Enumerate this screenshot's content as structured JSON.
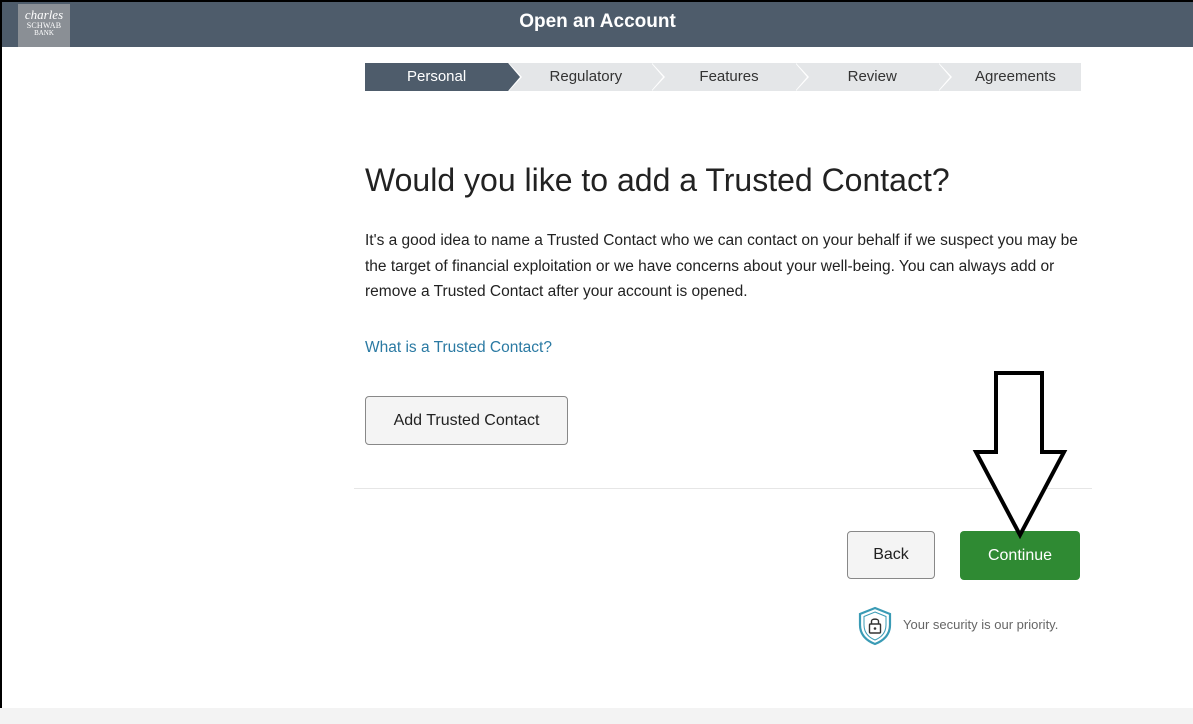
{
  "header": {
    "logo": {
      "line1": "charles",
      "line2": "SCHWAB",
      "line3": "BANK"
    },
    "title": "Open an Account"
  },
  "steps": [
    {
      "label": "Personal",
      "active": true
    },
    {
      "label": "Regulatory",
      "active": false
    },
    {
      "label": "Features",
      "active": false
    },
    {
      "label": "Review",
      "active": false
    },
    {
      "label": "Agreements",
      "active": false
    }
  ],
  "main": {
    "heading": "Would you like to add a Trusted Contact?",
    "description": "It's a good idea to name a Trusted Contact who we can contact on your behalf if we suspect you may be the target of financial exploitation or we have concerns about your well-being. You can always add or remove a Trusted Contact after your account is opened.",
    "link_text": "What is a Trusted Contact?",
    "add_button": "Add Trusted Contact"
  },
  "footer": {
    "back_label": "Back",
    "continue_label": "Continue",
    "security_text": "Your security is our priority.",
    "security_icon": "shield-lock-icon"
  },
  "colors": {
    "header_bg": "#4e5c6b",
    "continue_bg": "#2f8a33",
    "link": "#2b7aa3"
  }
}
